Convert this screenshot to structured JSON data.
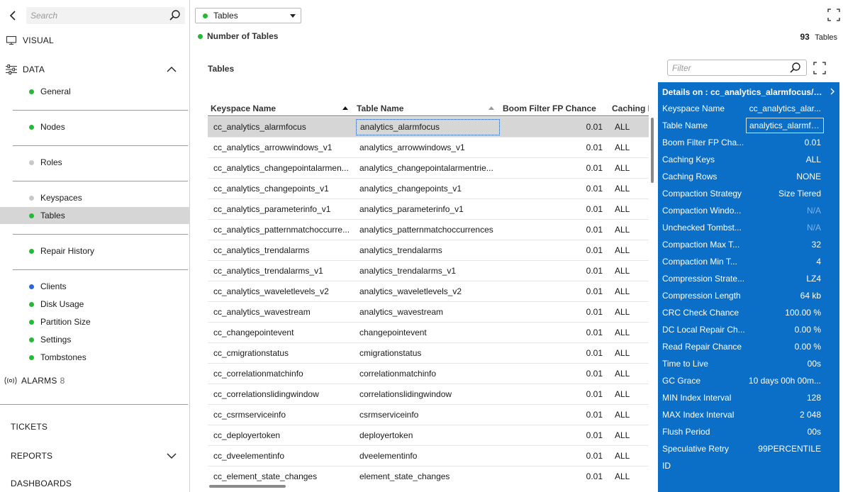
{
  "sidebar": {
    "search_placeholder": "Search",
    "visual_label": "VISUAL",
    "data_label": "DATA",
    "items_group1": [
      {
        "label": "General",
        "dot": "#22bb33"
      },
      {
        "label": "Nodes",
        "dot": "#22bb33"
      },
      {
        "label": "Roles",
        "dot": "#c8c8c8"
      },
      {
        "label": "Keyspaces",
        "dot": "#c8c8c8"
      },
      {
        "label": "Tables",
        "dot": "#22bb33"
      },
      {
        "label": "Repair History",
        "dot": "#22bb33"
      },
      {
        "label": "Clients",
        "dot": "#2a6bd8"
      },
      {
        "label": "Disk Usage",
        "dot": "#22bb33"
      },
      {
        "label": "Partition Size",
        "dot": "#22bb33"
      },
      {
        "label": "Settings",
        "dot": "#22bb33"
      },
      {
        "label": "Tombstones",
        "dot": "#22bb33"
      }
    ],
    "alarms_label": "ALARMS",
    "alarms_count": "8",
    "tickets_label": "TICKETS",
    "reports_label": "REPORTS",
    "dashboards_label": "DASHBOARDS"
  },
  "main": {
    "dropdown_value": "Tables",
    "dropdown_dot": "#22bb33",
    "num_tables_label": "Number of Tables",
    "num_tables_value": "93",
    "num_tables_unit": "Tables",
    "tables_section_title": "Tables",
    "filter_placeholder": "Filter",
    "columns": [
      "Keyspace Name",
      "Table Name",
      "Boom Filter FP Chance",
      "Caching K"
    ],
    "rows": [
      {
        "keyspace": "cc_analytics_alarmfocus",
        "table": "analytics_alarmfocus",
        "bf": "0.01",
        "caching": "ALL"
      },
      {
        "keyspace": "cc_analytics_arrowwindows_v1",
        "table": "analytics_arrowwindows_v1",
        "bf": "0.01",
        "caching": "ALL"
      },
      {
        "keyspace": "cc_analytics_changepointalarmen...",
        "table": "analytics_changepointalarmentrie...",
        "bf": "0.01",
        "caching": "ALL"
      },
      {
        "keyspace": "cc_analytics_changepoints_v1",
        "table": "analytics_changepoints_v1",
        "bf": "0.01",
        "caching": "ALL"
      },
      {
        "keyspace": "cc_analytics_parameterinfo_v1",
        "table": "analytics_parameterinfo_v1",
        "bf": "0.01",
        "caching": "ALL"
      },
      {
        "keyspace": "cc_analytics_patternmatchoccurre...",
        "table": "analytics_patternmatchoccurrences",
        "bf": "0.01",
        "caching": "ALL"
      },
      {
        "keyspace": "cc_analytics_trendalarms",
        "table": "analytics_trendalarms",
        "bf": "0.01",
        "caching": "ALL"
      },
      {
        "keyspace": "cc_analytics_trendalarms_v1",
        "table": "analytics_trendalarms_v1",
        "bf": "0.01",
        "caching": "ALL"
      },
      {
        "keyspace": "cc_analytics_waveletlevels_v2",
        "table": "analytics_waveletlevels_v2",
        "bf": "0.01",
        "caching": "ALL"
      },
      {
        "keyspace": "cc_analytics_wavestream",
        "table": "analytics_wavestream",
        "bf": "0.01",
        "caching": "ALL"
      },
      {
        "keyspace": "cc_changepointevent",
        "table": "changepointevent",
        "bf": "0.01",
        "caching": "ALL"
      },
      {
        "keyspace": "cc_cmigrationstatus",
        "table": "cmigrationstatus",
        "bf": "0.01",
        "caching": "ALL"
      },
      {
        "keyspace": "cc_correlationmatchinfo",
        "table": "correlationmatchinfo",
        "bf": "0.01",
        "caching": "ALL"
      },
      {
        "keyspace": "cc_correlationslidingwindow",
        "table": "correlationslidingwindow",
        "bf": "0.01",
        "caching": "ALL"
      },
      {
        "keyspace": "cc_csrmserviceinfo",
        "table": "csrmserviceinfo",
        "bf": "0.01",
        "caching": "ALL"
      },
      {
        "keyspace": "cc_deployertoken",
        "table": "deployertoken",
        "bf": "0.01",
        "caching": "ALL"
      },
      {
        "keyspace": "cc_dveelementinfo",
        "table": "dveelementinfo",
        "bf": "0.01",
        "caching": "ALL"
      },
      {
        "keyspace": "cc_element_state_changes",
        "table": "element_state_changes",
        "bf": "0.01",
        "caching": "ALL"
      }
    ]
  },
  "details": {
    "title": "Details on : cc_analytics_alarmfocus/ana...",
    "rows": [
      {
        "key": "Keyspace Name",
        "value": "cc_analytics_alar..."
      },
      {
        "key": "Table Name",
        "value": "analytics_alarmfo..."
      },
      {
        "key": "Boom Filter FP Cha...",
        "value": "0.01"
      },
      {
        "key": "Caching Keys",
        "value": "ALL"
      },
      {
        "key": "Caching Rows",
        "value": "NONE"
      },
      {
        "key": "Compaction Strategy",
        "value": "Size Tiered"
      },
      {
        "key": "Compaction Windo...",
        "value": "N/A"
      },
      {
        "key": "Unchecked Tombst...",
        "value": "N/A"
      },
      {
        "key": "Compaction Max T...",
        "value": "32"
      },
      {
        "key": "Compaction Min T...",
        "value": "4"
      },
      {
        "key": "Compression Strate...",
        "value": "LZ4"
      },
      {
        "key": "Compression Length",
        "value": "64 kb"
      },
      {
        "key": "CRC Check Chance",
        "value": "100.00 %"
      },
      {
        "key": "DC Local Repair Ch...",
        "value": "0.00 %"
      },
      {
        "key": "Read Repair Chance",
        "value": "0.00 %"
      },
      {
        "key": "Time to Live",
        "value": "00s"
      },
      {
        "key": "GC Grace",
        "value": "10 days 00h 00m..."
      },
      {
        "key": "MIN Index Interval",
        "value": "128"
      },
      {
        "key": "MAX Index Interval",
        "value": "2 048"
      },
      {
        "key": "Flush Period",
        "value": "00s"
      },
      {
        "key": "Speculative Retry",
        "value": "99PERCENTILE"
      },
      {
        "key": "ID",
        "value": ""
      }
    ]
  }
}
